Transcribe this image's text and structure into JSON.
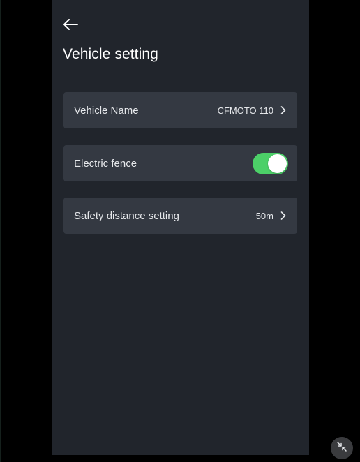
{
  "header": {
    "title": "Vehicle setting",
    "back_icon": "arrow-left-icon"
  },
  "settings": {
    "vehicle_name": {
      "label": "Vehicle Name",
      "value": "CFMOTO 110",
      "icon": "chevron-right-icon"
    },
    "electric_fence": {
      "label": "Electric fence",
      "enabled": true
    },
    "safety_distance": {
      "label": "Safety distance setting",
      "value": "50m",
      "icon": "chevron-right-icon"
    }
  },
  "overlay": {
    "collapse_icon": "collapse-arrows-icon"
  },
  "colors": {
    "background": "#000000",
    "screen": "#21252c",
    "card": "#343942",
    "text": "#e6e8eb",
    "toggle_on": "#4cd068"
  }
}
